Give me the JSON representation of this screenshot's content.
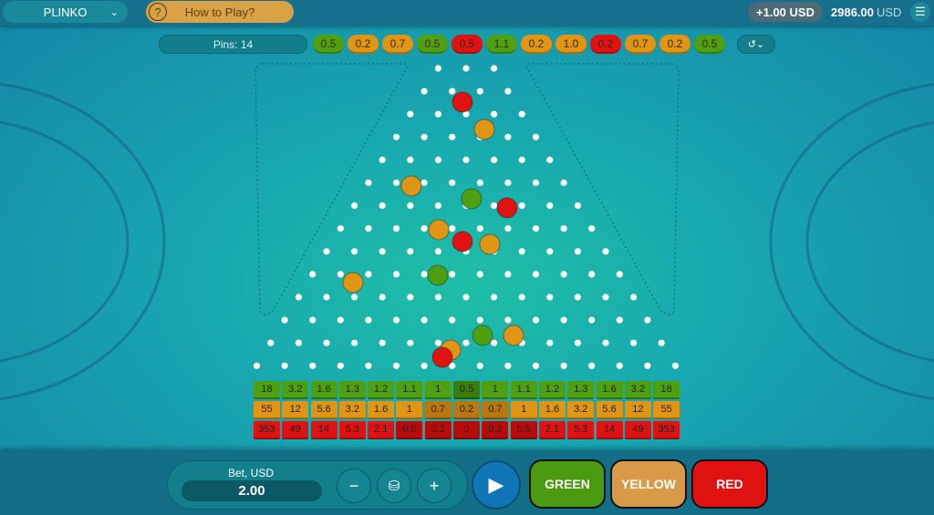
{
  "header": {
    "game": "PLINKO",
    "how_to_play": "How to Play?",
    "last_win": "+1.00 USD",
    "balance": "2986.00",
    "currency": "USD"
  },
  "pins": {
    "label": "Pins: 14",
    "count": 14
  },
  "history": [
    {
      "v": "0.5",
      "c": "green"
    },
    {
      "v": "0.2",
      "c": "yellow"
    },
    {
      "v": "0.7",
      "c": "yellow"
    },
    {
      "v": "0.5",
      "c": "green"
    },
    {
      "v": "0.5",
      "c": "red"
    },
    {
      "v": "1.1",
      "c": "green"
    },
    {
      "v": "0.2",
      "c": "yellow"
    },
    {
      "v": "1.0",
      "c": "yellow"
    },
    {
      "v": "0.2",
      "c": "red"
    },
    {
      "v": "0.7",
      "c": "yellow"
    },
    {
      "v": "0.2",
      "c": "yellow"
    },
    {
      "v": "0.5",
      "c": "green"
    }
  ],
  "colors": {
    "green": "#4ea012",
    "yellow": "#e09514",
    "red": "#e01212"
  },
  "payouts": {
    "green": [
      "18",
      "3.2",
      "1.6",
      "1.3",
      "1.2",
      "1.1",
      "1",
      "0.5",
      "1",
      "1.1",
      "1.2",
      "1.3",
      "1.6",
      "3.2",
      "18"
    ],
    "yellow": [
      "55",
      "12",
      "5.6",
      "3.2",
      "1.6",
      "1",
      "0.7",
      "0.2",
      "0.7",
      "1",
      "1.6",
      "3.2",
      "5.6",
      "12",
      "55"
    ],
    "red": [
      "353",
      "49",
      "14",
      "5.3",
      "2.1",
      "0.5",
      "0.2",
      "0",
      "0.2",
      "0.5",
      "2.1",
      "5.3",
      "14",
      "49",
      "353"
    ]
  },
  "bet": {
    "label": "Bet, USD",
    "value": "2.00",
    "minus": "−",
    "plus": "+"
  },
  "buttons": {
    "green": "GREEN",
    "yellow": "YELLOW",
    "red": "RED"
  }
}
